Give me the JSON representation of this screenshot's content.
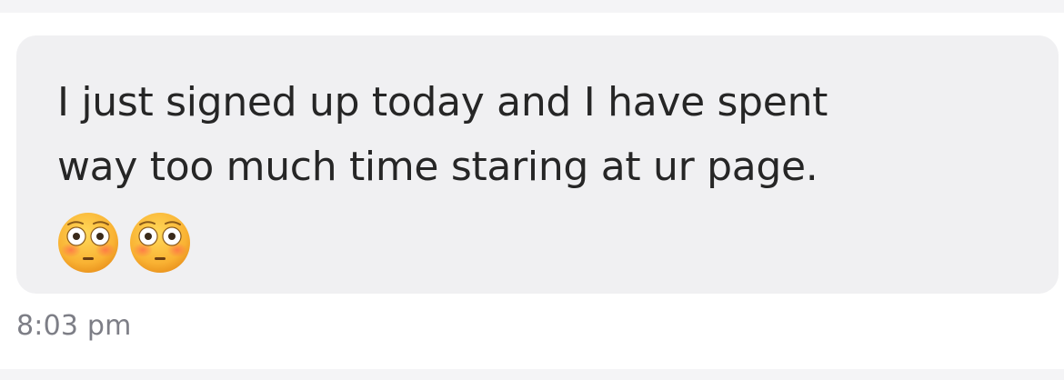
{
  "message": {
    "text_line1": "I just signed up today and I have spent",
    "text_line2": "way too much time staring at ur page.",
    "emojis": [
      "flushed-face-icon",
      "flushed-face-icon"
    ],
    "timestamp": "8:03 pm"
  },
  "colors": {
    "bubble": "#f0f0f2",
    "text": "#262626",
    "timestamp": "#7d7e86",
    "page_background": "#ffffff",
    "outer_background": "#f4f4f6"
  }
}
